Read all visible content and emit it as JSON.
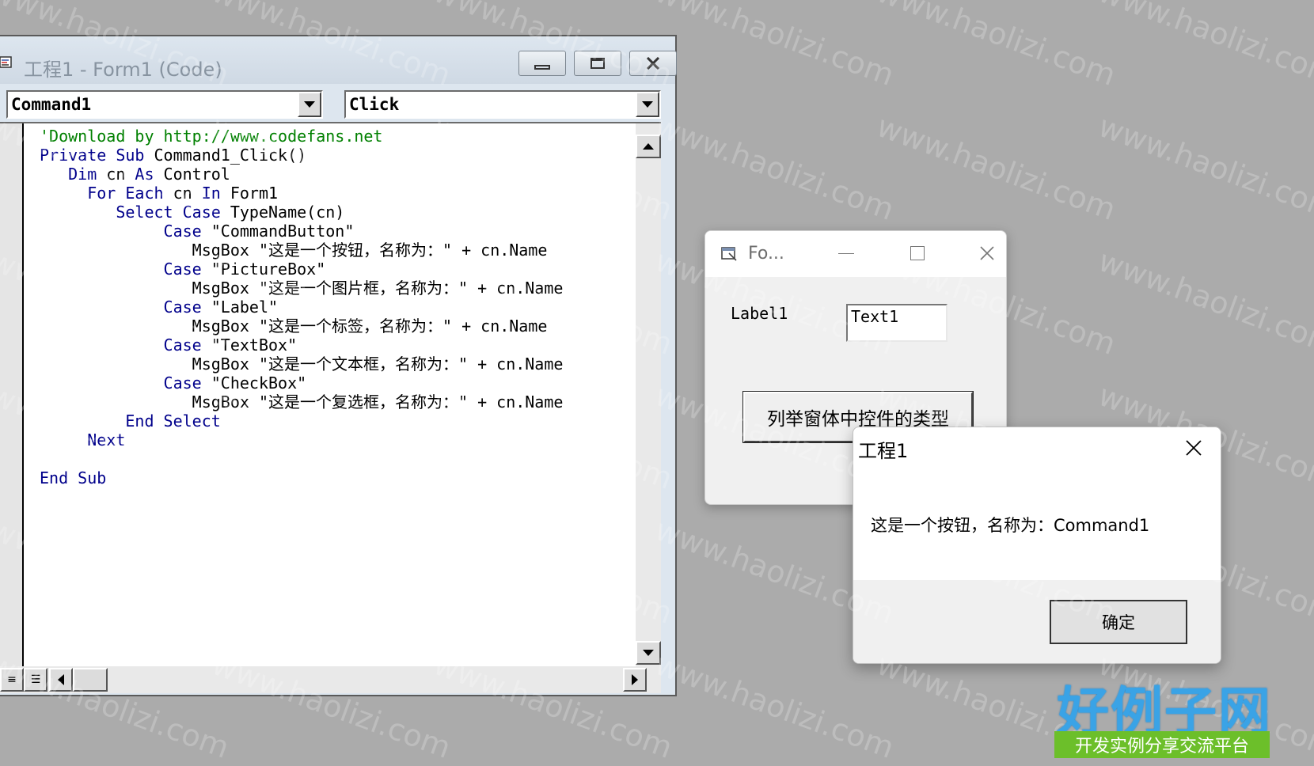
{
  "code_window": {
    "title": "工程1 - Form1 (Code)",
    "object_combo": "Command1",
    "proc_combo": "Click",
    "lines": [
      [
        {
          "t": "'Download by http://www.codefans.net",
          "c": "cm"
        }
      ],
      [
        {
          "t": "Private Sub ",
          "c": "kw"
        },
        {
          "t": "Command1_Click()",
          "c": ""
        }
      ],
      [
        {
          "t": "   Dim ",
          "c": "kw"
        },
        {
          "t": "cn ",
          "c": ""
        },
        {
          "t": "As ",
          "c": "kw"
        },
        {
          "t": "Control",
          "c": ""
        }
      ],
      [
        {
          "t": "     For Each ",
          "c": "kw"
        },
        {
          "t": "cn ",
          "c": ""
        },
        {
          "t": "In ",
          "c": "kw"
        },
        {
          "t": "Form1",
          "c": ""
        }
      ],
      [
        {
          "t": "        Select Case ",
          "c": "kw"
        },
        {
          "t": "TypeName(cn)",
          "c": ""
        }
      ],
      [
        {
          "t": "             Case ",
          "c": "kw"
        },
        {
          "t": "\"CommandButton\"",
          "c": ""
        }
      ],
      [
        {
          "t": "                MsgBox \"这是一个按钮，名称为：\" + cn.Name",
          "c": ""
        }
      ],
      [
        {
          "t": "             Case ",
          "c": "kw"
        },
        {
          "t": "\"PictureBox\"",
          "c": ""
        }
      ],
      [
        {
          "t": "                MsgBox \"这是一个图片框，名称为：\" + cn.Name",
          "c": ""
        }
      ],
      [
        {
          "t": "             Case ",
          "c": "kw"
        },
        {
          "t": "\"Label\"",
          "c": ""
        }
      ],
      [
        {
          "t": "                MsgBox \"这是一个标签，名称为：\" + cn.Name",
          "c": ""
        }
      ],
      [
        {
          "t": "             Case ",
          "c": "kw"
        },
        {
          "t": "\"TextBox\"",
          "c": ""
        }
      ],
      [
        {
          "t": "                MsgBox \"这是一个文本框，名称为：\" + cn.Name",
          "c": ""
        }
      ],
      [
        {
          "t": "             Case ",
          "c": "kw"
        },
        {
          "t": "\"CheckBox\"",
          "c": ""
        }
      ],
      [
        {
          "t": "                MsgBox \"这是一个复选框，名称为：\" + cn.Name",
          "c": ""
        }
      ],
      [
        {
          "t": "         End Select",
          "c": "kw"
        }
      ],
      [
        {
          "t": "     Next",
          "c": "kw"
        }
      ],
      [
        {
          "t": "",
          "c": ""
        }
      ],
      [
        {
          "t": "End Sub",
          "c": "kw"
        }
      ]
    ]
  },
  "form_window": {
    "title": "Fo...",
    "label": "Label1",
    "textbox_value": "Text1",
    "button_label": "列举窗体中控件的类型"
  },
  "msgbox": {
    "title": "工程1",
    "message": "这是一个按钮，名称为：Command1",
    "ok_label": "确定"
  },
  "watermark": "www.haolizi.com",
  "logo": {
    "main": "好例子网",
    "sub": "开发实例分享交流平台"
  },
  "colors": {
    "keyword": "#00008b",
    "comment": "#008000",
    "desktop": "#ababab"
  }
}
